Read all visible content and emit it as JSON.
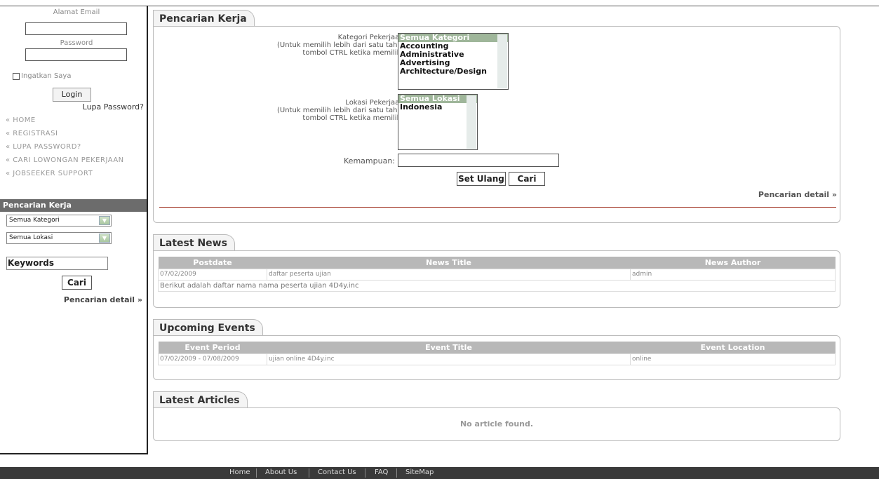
{
  "sidebar": {
    "email_label": "Alamat Email",
    "password_label": "Password",
    "remember_label": "Ingatkan Saya",
    "login_label": "Login",
    "forgot_label": "Lupa Password?",
    "nav": [
      "« HOME",
      "« REGISTRASI",
      "« LUPA PASSWORD?",
      "« CARI LOWONGAN PEKERJAAN",
      "« JOBSEEKER SUPPORT"
    ],
    "search_title": "Pencarian Kerja",
    "category_value": "Semua Kategori",
    "location_value": "Semua Lokasi",
    "keywords_value": "Keywords",
    "search_button": "Cari",
    "detail_link": "Pencarian detail »"
  },
  "job_search": {
    "tab": "Pencarian Kerja",
    "category_label": "Kategori Pekerjaan:",
    "category_hint1": "(Untuk memilih lebih dari satu tahan",
    "category_hint2": "tombol CTRL ketika memilih.)",
    "categories": [
      "Semua Kategori",
      "Accounting",
      "Administrative",
      "Advertising",
      "Architecture/Design"
    ],
    "location_label": "Lokasi Pekerjaan:",
    "location_hint1": "(Untuk memilih lebih dari satu tahan",
    "location_hint2": "tombol CTRL ketika memilih.)",
    "locations": [
      "Semua Lokasi",
      "Indonesia"
    ],
    "skill_label": "Kemampuan:",
    "reset_button": "Set Ulang",
    "search_button": "Cari",
    "detail_link": "Pencarian detail »"
  },
  "news": {
    "tab": "Latest News",
    "headers": [
      "Postdate",
      "News Title",
      "News Author"
    ],
    "rows": [
      {
        "date": "07/02/2009",
        "title": "daftar peserta ujian",
        "author": "admin"
      }
    ],
    "summary": "Berikut adalah daftar nama nama peserta ujian 4D4y.inc"
  },
  "events": {
    "tab": "Upcoming Events",
    "headers": [
      "Event Period",
      "Event Title",
      "Event Location"
    ],
    "rows": [
      {
        "period": "07/02/2009 - 07/08/2009",
        "title": "ujian online 4D4y.inc",
        "location": "online"
      }
    ]
  },
  "articles": {
    "tab": "Latest Articles",
    "empty": "No article found."
  },
  "footer": [
    "Home",
    "About Us",
    "Contact Us",
    "FAQ",
    "SiteMap"
  ]
}
